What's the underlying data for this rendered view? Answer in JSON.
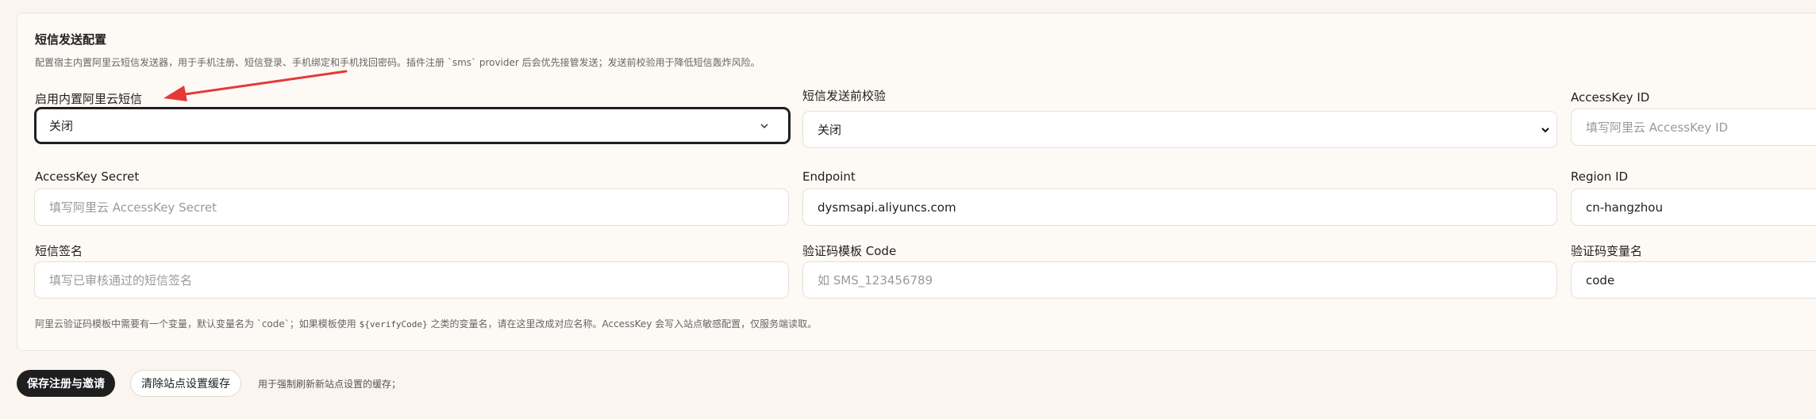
{
  "section": {
    "title": "短信发送配置",
    "description": "配置宿主内置阿里云短信发送器，用于手机注册、短信登录、手机绑定和手机找回密码。插件注册 `sms` provider 后会优先接管发送；发送前校验用于降低短信轰炸风险。"
  },
  "fields": {
    "enable_builtin": {
      "label": "启用内置阿里云短信",
      "value": "关闭"
    },
    "pre_send_check": {
      "label": "短信发送前校验",
      "value": "关闭"
    },
    "access_key_id": {
      "label": "AccessKey ID",
      "value": "",
      "placeholder": "填写阿里云 AccessKey ID"
    },
    "access_key_secret": {
      "label": "AccessKey Secret",
      "value": "",
      "placeholder": "填写阿里云 AccessKey Secret"
    },
    "endpoint": {
      "label": "Endpoint",
      "value": "dysmsapi.aliyuncs.com",
      "placeholder": ""
    },
    "region_id": {
      "label": "Region ID",
      "value": "cn-hangzhou",
      "placeholder": ""
    },
    "sign_name": {
      "label": "短信签名",
      "value": "",
      "placeholder": "填写已审核通过的短信签名"
    },
    "template_code": {
      "label": "验证码模板 Code",
      "value": "",
      "placeholder": "如 SMS_123456789"
    },
    "code_variable": {
      "label": "验证码变量名",
      "value": "code",
      "placeholder": ""
    }
  },
  "note": {
    "before": "阿里云验证码模板中需要有一个变量，默认变量名为 `code`；如果模板使用 ",
    "code": "${verifyCode}",
    "after": " 之类的变量名，请在这里改成对应名称。AccessKey 会写入站点敏感配置，仅服务端读取。"
  },
  "actions": {
    "save_label": "保存注册与邀请",
    "clear_cache_label": "清除站点设置缓存",
    "clear_cache_hint": "用于强制刷新新站点设置的缓存；"
  },
  "colors": {
    "page_bg": "#fbf5ef",
    "primary": "#1f1f1f",
    "annotation_arrow": "#e53935"
  },
  "icons": {
    "select_chevron": "chevron-down-icon",
    "annotation": "red-arrow-annotation"
  }
}
